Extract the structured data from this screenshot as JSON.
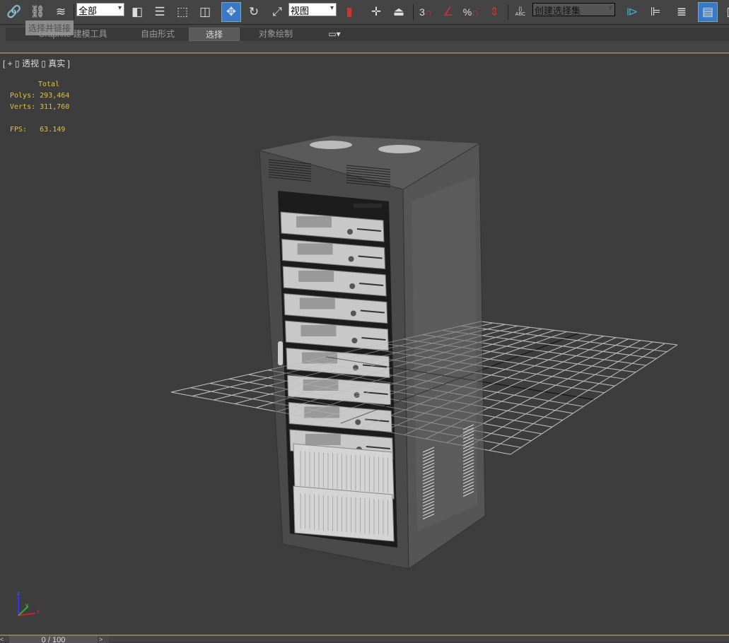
{
  "toolbar": {
    "tools": [
      "link-icon",
      "unlink-icon",
      "bind-space-warp-icon",
      "select-object-icon",
      "select-by-name-icon",
      "rect-region-icon",
      "window-crossing-icon",
      "move-icon",
      "rotate-icon",
      "scale-icon",
      "pivot-icon",
      "select-manipulate-icon",
      "snap-3-icon",
      "angle-snap-icon",
      "percent-snap-icon",
      "spinner-snap-icon",
      "edit-named-selection-icon",
      "mirror-icon",
      "align-icon",
      "layer-manager-icon",
      "scene-explorer-icon"
    ],
    "selection_filter": "全部",
    "reference_coord": "视图",
    "named_selection": "创建选择集",
    "snap_label": "3",
    "percent_label": "%",
    "abc_label": "ABC",
    "tooltip": "选择并链接"
  },
  "ribbon": {
    "tabs": [
      "Graphite 建模工具",
      "自由形式",
      "选择",
      "对象绘制"
    ],
    "active_tab": "选择"
  },
  "viewport": {
    "label": "[ + ▯ 透视 ▯ 真实 ]",
    "stats": {
      "header": "Total",
      "polys_label": "Polys:",
      "polys": "293,464",
      "verts_label": "Verts:",
      "verts": "311,760",
      "fps_label": "FPS:",
      "fps": "63.149"
    },
    "axis": {
      "z": "z",
      "y": "y",
      "x": "x"
    }
  },
  "timeline": {
    "prev": "<",
    "frame": "0 / 100",
    "next": ">"
  },
  "colors": {
    "accent": "#3a78c8",
    "stats": "#e0c040",
    "viewport": "#3d3d3d"
  }
}
